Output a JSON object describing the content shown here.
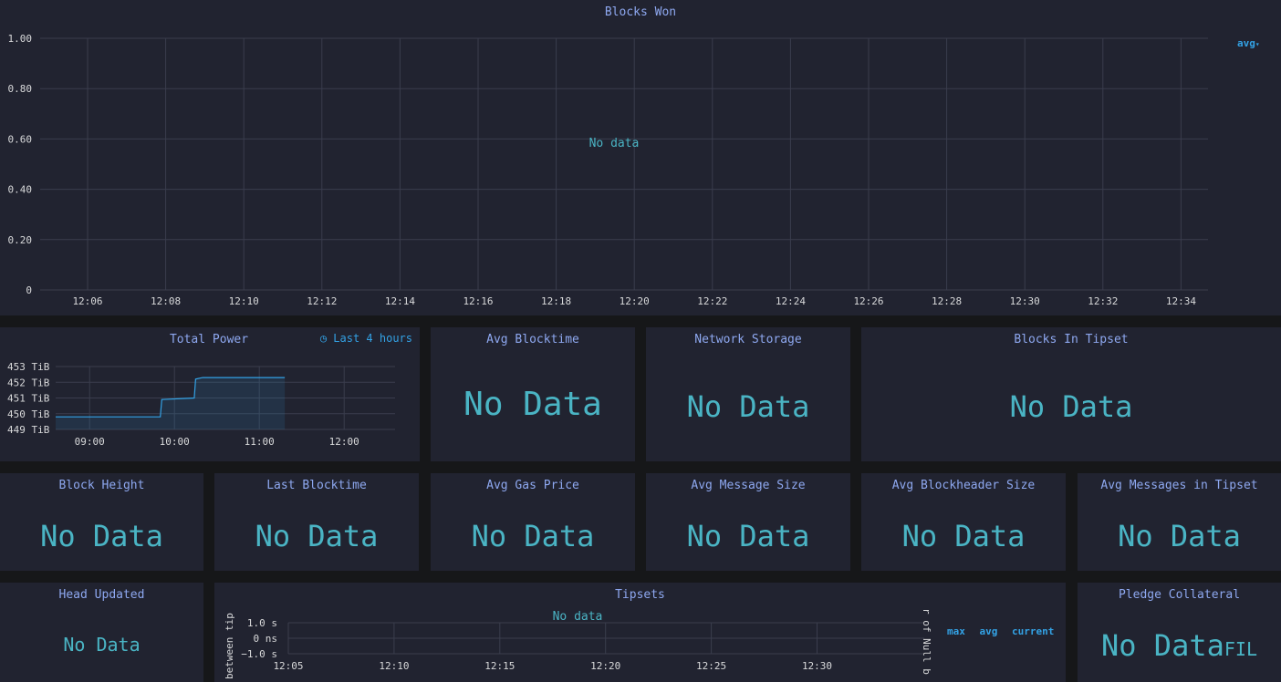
{
  "blocks_won": {
    "title": "Blocks Won",
    "no_data": "No data",
    "legend": "avg",
    "y_ticks": [
      "1.00",
      "0.80",
      "0.60",
      "0.40",
      "0.20",
      "0"
    ],
    "x_ticks": [
      "12:06",
      "12:08",
      "12:10",
      "12:12",
      "12:14",
      "12:16",
      "12:18",
      "12:20",
      "12:22",
      "12:24",
      "12:26",
      "12:28",
      "12:30",
      "12:32",
      "12:34"
    ]
  },
  "total_power": {
    "title": "Total Power",
    "time_range": "Last 4 hours",
    "chart_data": {
      "type": "area",
      "y_ticks": [
        "453 TiB",
        "452 TiB",
        "451 TiB",
        "450 TiB",
        "449 TiB"
      ],
      "x_ticks": [
        "09:00",
        "10:00",
        "11:00",
        "12:00"
      ],
      "ylim": [
        449,
        453
      ],
      "xlim": [
        "08:36",
        "12:36"
      ],
      "series": [
        {
          "x": [
            "08:36",
            "09:20",
            "09:50",
            "09:51",
            "10:14",
            "10:15",
            "10:20",
            "11:00",
            "11:18"
          ],
          "values": [
            449.8,
            449.8,
            449.8,
            450.9,
            451.0,
            452.2,
            452.3,
            452.3,
            452.3
          ]
        }
      ]
    }
  },
  "avg_blocktime": {
    "title": "Avg Blocktime",
    "value": "No Data"
  },
  "network_storage": {
    "title": "Network Storage",
    "value": "No Data"
  },
  "blocks_in_tipset": {
    "title": "Blocks In Tipset",
    "value": "No Data"
  },
  "block_height": {
    "title": "Block Height",
    "value": "No Data"
  },
  "last_blocktime": {
    "title": "Last Blocktime",
    "value": "No Data"
  },
  "avg_gas_price": {
    "title": "Avg Gas Price",
    "value": "No Data"
  },
  "avg_message_size": {
    "title": "Avg Message Size",
    "value": "No Data"
  },
  "avg_blockheader_size": {
    "title": "Avg Blockheader Size",
    "value": "No Data"
  },
  "avg_messages_in_tipset": {
    "title": "Avg Messages in Tipset",
    "value": "No Data"
  },
  "head_updated": {
    "title": "Head Updated",
    "value": "No Data"
  },
  "tipsets": {
    "title": "Tipsets",
    "no_data": "No data",
    "y_ticks": [
      "1.0 s",
      "0 ns",
      "−1.0 s"
    ],
    "x_ticks": [
      "12:05",
      "12:10",
      "12:15",
      "12:20",
      "12:25",
      "12:30"
    ],
    "left_axis_label": "between tip",
    "right_axis_label": "r of Null b",
    "legend": [
      "max",
      "avg",
      "current"
    ]
  },
  "pledge_collateral": {
    "title": "Pledge Collateral",
    "value": "No Data",
    "unit": "FIL"
  },
  "colors": {
    "accent": "#4ab4c4",
    "title": "#8ea8f0",
    "series": "#33a2e5",
    "panel": "#212330"
  }
}
